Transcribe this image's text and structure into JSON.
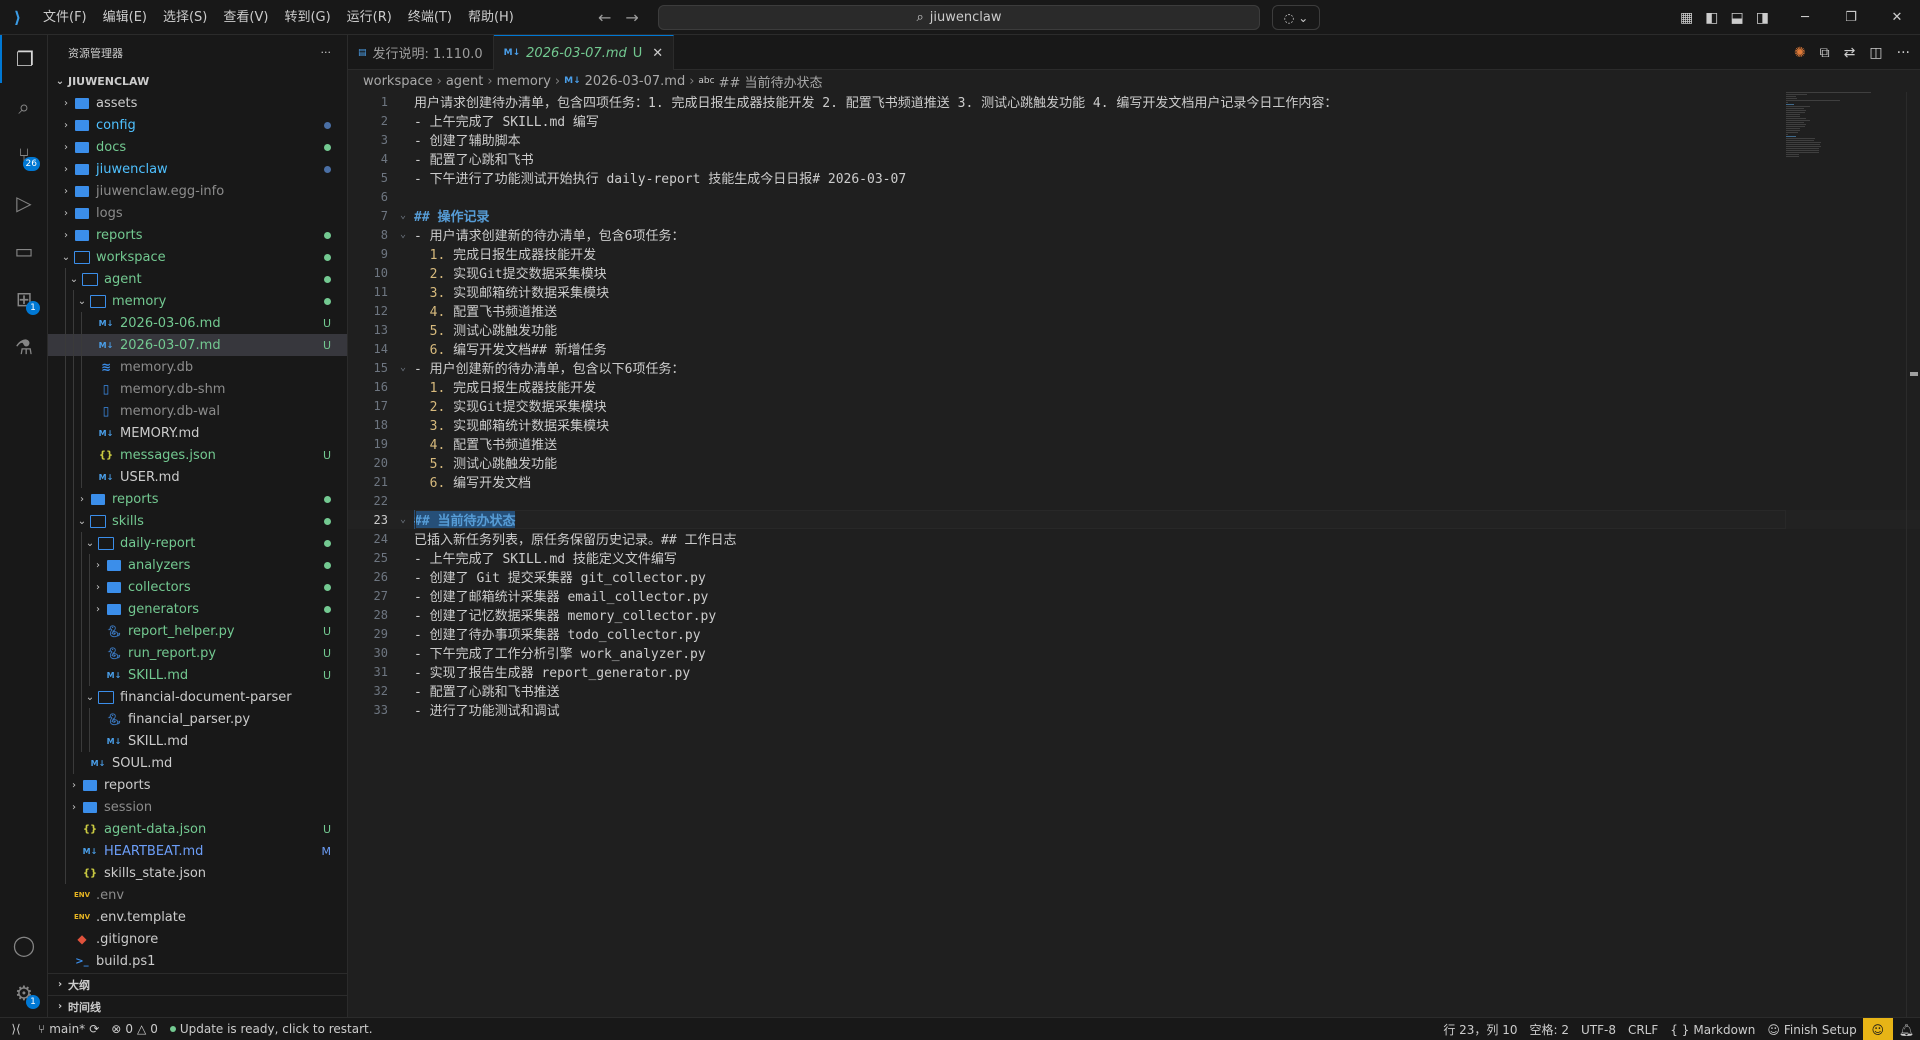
{
  "titlebar": {
    "menus": [
      "文件(F)",
      "编辑(E)",
      "选择(S)",
      "查看(V)",
      "转到(G)",
      "运行(R)",
      "终端(T)",
      "帮助(H)"
    ],
    "search_text": "jiuwenclaw",
    "back_icon": "arrow-left",
    "forward_icon": "arrow-right"
  },
  "activitybar": {
    "items": [
      {
        "name": "explorer",
        "icon": "files-icon",
        "active": true
      },
      {
        "name": "search",
        "icon": "search-icon"
      },
      {
        "name": "source-control",
        "icon": "git-icon",
        "badge": "26"
      },
      {
        "name": "run-debug",
        "icon": "debug-icon"
      },
      {
        "name": "remote-explorer",
        "icon": "remote-icon"
      },
      {
        "name": "extensions",
        "icon": "extensions-icon",
        "badge": "1"
      },
      {
        "name": "testing",
        "icon": "beaker-icon"
      }
    ],
    "bottom": [
      {
        "name": "accounts",
        "icon": "account-icon"
      },
      {
        "name": "manage",
        "icon": "gear-icon",
        "badge": "1"
      }
    ]
  },
  "sidebar": {
    "title": "资源管理器",
    "more": "···",
    "root": "JIUWENCLAW",
    "tree": [
      {
        "label": "assets",
        "type": "folder",
        "depth": 1,
        "twisty": "closed",
        "color": "normal"
      },
      {
        "label": "config",
        "type": "folder",
        "depth": 1,
        "twisty": "closed",
        "color": "blue",
        "deco": "dot-blue"
      },
      {
        "label": "docs",
        "type": "folder",
        "depth": 1,
        "twisty": "closed",
        "color": "green",
        "deco": "dot-green"
      },
      {
        "label": "jiuwenclaw",
        "type": "folder",
        "depth": 1,
        "twisty": "closed",
        "color": "blue",
        "deco": "dot-blue"
      },
      {
        "label": "jiuwenclaw.egg-info",
        "type": "folder",
        "depth": 1,
        "twisty": "closed",
        "color": "dim"
      },
      {
        "label": "logs",
        "type": "folder",
        "depth": 1,
        "twisty": "closed",
        "color": "dim"
      },
      {
        "label": "reports",
        "type": "folder",
        "depth": 1,
        "twisty": "closed",
        "color": "green",
        "deco": "dot-green"
      },
      {
        "label": "workspace",
        "type": "folder-open",
        "depth": 1,
        "twisty": "open",
        "color": "green",
        "deco": "dot-green"
      },
      {
        "label": "agent",
        "type": "folder-open",
        "depth": 2,
        "twisty": "open",
        "color": "green",
        "deco": "dot-green"
      },
      {
        "label": "memory",
        "type": "folder-open",
        "depth": 3,
        "twisty": "open",
        "color": "green",
        "deco": "dot-green"
      },
      {
        "label": "2026-03-06.md",
        "type": "md",
        "depth": 4,
        "color": "green",
        "deco": "U"
      },
      {
        "label": "2026-03-07.md",
        "type": "md",
        "depth": 4,
        "color": "green",
        "deco": "U",
        "selected": true
      },
      {
        "label": "memory.db",
        "type": "db",
        "depth": 4,
        "color": "dim"
      },
      {
        "label": "memory.db-shm",
        "type": "file",
        "depth": 4,
        "color": "dim"
      },
      {
        "label": "memory.db-wal",
        "type": "file",
        "depth": 4,
        "color": "dim"
      },
      {
        "label": "MEMORY.md",
        "type": "md",
        "depth": 4,
        "color": "normal"
      },
      {
        "label": "messages.json",
        "type": "json",
        "depth": 4,
        "color": "green",
        "deco": "U"
      },
      {
        "label": "USER.md",
        "type": "md",
        "depth": 4,
        "color": "normal"
      },
      {
        "label": "reports",
        "type": "folder",
        "depth": 3,
        "twisty": "closed",
        "color": "green",
        "deco": "dot-green"
      },
      {
        "label": "skills",
        "type": "folder-open",
        "depth": 3,
        "twisty": "open",
        "color": "green",
        "deco": "dot-green"
      },
      {
        "label": "daily-report",
        "type": "folder-open",
        "depth": 4,
        "twisty": "open",
        "color": "green",
        "deco": "dot-green"
      },
      {
        "label": "analyzers",
        "type": "folder",
        "depth": 5,
        "twisty": "closed",
        "color": "green",
        "deco": "dot-green"
      },
      {
        "label": "collectors",
        "type": "folder",
        "depth": 5,
        "twisty": "closed",
        "color": "green",
        "deco": "dot-green"
      },
      {
        "label": "generators",
        "type": "folder",
        "depth": 5,
        "twisty": "closed",
        "color": "green",
        "deco": "dot-green"
      },
      {
        "label": "report_helper.py",
        "type": "py",
        "depth": 5,
        "color": "green",
        "deco": "U"
      },
      {
        "label": "run_report.py",
        "type": "py",
        "depth": 5,
        "color": "green",
        "deco": "U"
      },
      {
        "label": "SKILL.md",
        "type": "md",
        "depth": 5,
        "color": "green",
        "deco": "U"
      },
      {
        "label": "financial-document-parser",
        "type": "folder-open",
        "depth": 4,
        "twisty": "open",
        "color": "normal"
      },
      {
        "label": "financial_parser.py",
        "type": "py",
        "depth": 5,
        "color": "normal"
      },
      {
        "label": "SKILL.md",
        "type": "md",
        "depth": 5,
        "color": "normal"
      },
      {
        "label": "SOUL.md",
        "type": "md",
        "depth": 3,
        "color": "normal"
      },
      {
        "label": "reports",
        "type": "folder",
        "depth": 2,
        "twisty": "closed",
        "color": "normal"
      },
      {
        "label": "session",
        "type": "folder",
        "depth": 2,
        "twisty": "closed",
        "color": "dim"
      },
      {
        "label": "agent-data.json",
        "type": "json",
        "depth": 2,
        "color": "green",
        "deco": "U"
      },
      {
        "label": "HEARTBEAT.md",
        "type": "md",
        "depth": 2,
        "color": "blue-mod",
        "deco": "M"
      },
      {
        "label": "skills_state.json",
        "type": "json",
        "depth": 2,
        "color": "normal"
      },
      {
        "label": ".env",
        "type": "env",
        "depth": 1,
        "color": "dim"
      },
      {
        "label": ".env.template",
        "type": "env",
        "depth": 1,
        "color": "normal"
      },
      {
        "label": ".gitignore",
        "type": "git",
        "depth": 1,
        "color": "normal"
      },
      {
        "label": "build.ps1",
        "type": "ps",
        "depth": 1,
        "color": "normal"
      }
    ],
    "outline": "大纲",
    "timeline": "时间线"
  },
  "tabs": [
    {
      "label": "发行说明: 1.110.0",
      "icon": "preview-icon",
      "active": false
    },
    {
      "label": "2026-03-07.md",
      "icon": "markdown-icon",
      "active": true,
      "status": "U"
    }
  ],
  "breadcrumb": [
    "workspace",
    "agent",
    "memory",
    "2026-03-07.md",
    "## 当前待办状态"
  ],
  "editor": {
    "current_line": 23,
    "lines": [
      "用户请求创建待办清单，包含四项任务：1. 完成日报生成器技能开发 2. 配置飞书频道推送 3. 测试心跳触发功能 4. 编写开发文档用户记录今日工作内容：",
      "- 上午完成了 SKILL.md 编写",
      "- 创建了辅助脚本",
      "- 配置了心跳和飞书",
      "- 下午进行了功能测试开始执行 daily-report 技能生成今日日报# 2026-03-07",
      "",
      "## 操作记录",
      "- 用户请求创建新的待办清单，包含6项任务：",
      "  1. 完成日报生成器技能开发",
      "  2. 实现Git提交数据采集模块",
      "  3. 实现邮箱统计数据采集模块",
      "  4. 配置飞书频道推送",
      "  5. 测试心跳触发功能",
      "  6. 编写开发文档## 新增任务",
      "- 用户创建新的待办清单，包含以下6项任务：",
      "  1. 完成日报生成器技能开发",
      "  2. 实现Git提交数据采集模块",
      "  3. 实现邮箱统计数据采集模块",
      "  4. 配置飞书频道推送",
      "  5. 测试心跳触发功能",
      "  6. 编写开发文档",
      "",
      "## 当前待办状态",
      "已插入新任务列表，原任务保留历史记录。## 工作日志",
      "- 上午完成了 SKILL.md 技能定义文件编写",
      "- 创建了 Git 提交采集器 git_collector.py",
      "- 创建了邮箱统计采集器 email_collector.py",
      "- 创建了记忆数据采集器 memory_collector.py",
      "- 创建了待办事项采集器 todo_collector.py",
      "- 下午完成了工作分析引擎 work_analyzer.py",
      "- 实现了报告生成器 report_generator.py",
      "- 配置了心跳和飞书推送",
      "- 进行了功能测试和调试"
    ]
  },
  "statusbar": {
    "branch": "main*",
    "errors": "0",
    "warnings": "0",
    "update": "Update is ready, click to restart.",
    "position": "行 23，列 10",
    "spaces": "空格: 2",
    "encoding": "UTF-8",
    "eol": "CRLF",
    "language": "Markdown",
    "finish_setup": "Finish Setup"
  }
}
